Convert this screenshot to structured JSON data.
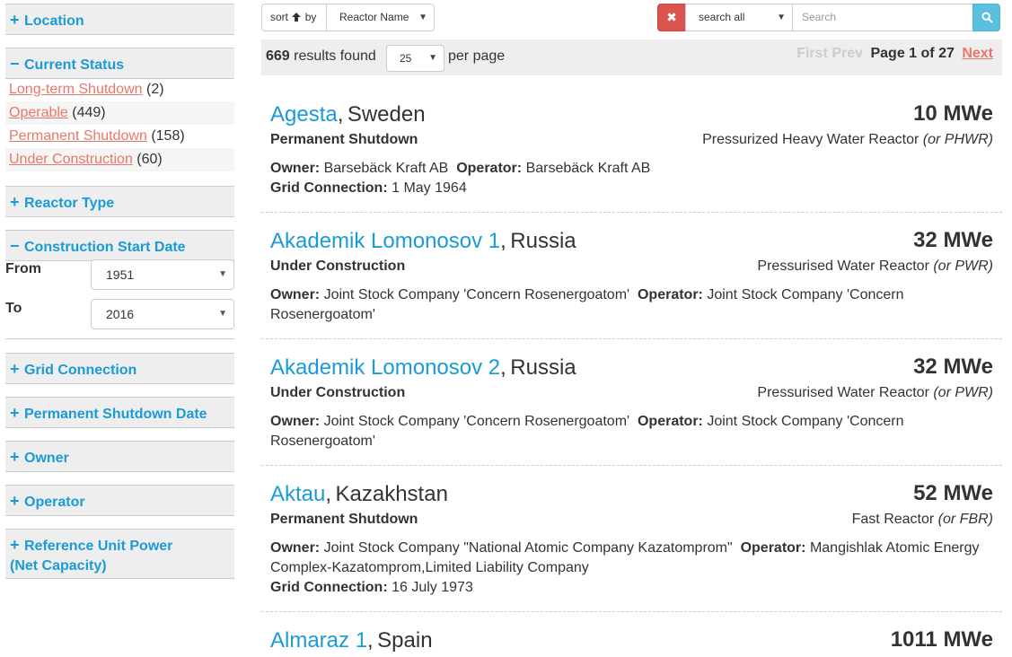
{
  "sidebar": {
    "location": {
      "sym": "+",
      "label": "Location"
    },
    "current_status": {
      "sym": "−",
      "label": "Current Status",
      "items": [
        {
          "label": "Long-term Shutdown",
          "count": "(2)"
        },
        {
          "label": "Operable",
          "count": "(449)"
        },
        {
          "label": "Permanent Shutdown",
          "count": "(158)"
        },
        {
          "label": "Under Construction",
          "count": "(60)"
        }
      ]
    },
    "reactor_type": {
      "sym": "+",
      "label": "Reactor Type"
    },
    "construction_start": {
      "sym": "−",
      "label": "Construction Start Date",
      "from_label": "From",
      "from_value": "1951",
      "to_label": "To",
      "to_value": "2016"
    },
    "grid_connection": {
      "sym": "+",
      "label": "Grid Connection"
    },
    "perm_shutdown_date": {
      "sym": "+",
      "label": "Permanent Shutdown Date"
    },
    "owner": {
      "sym": "+",
      "label": "Owner"
    },
    "operator": {
      "sym": "+",
      "label": "Operator"
    },
    "ref_unit_power": {
      "sym": "+",
      "label_line1": "Reference Unit Power",
      "label_line2": "(Net Capacity)"
    }
  },
  "toolbar": {
    "sort_label": "sort",
    "sort_by": "by",
    "sort_field": "Reactor Name",
    "clear_symbol": "✖",
    "search_scope": "search all",
    "search_placeholder": "Search"
  },
  "results_bar": {
    "count": "669",
    "count_suffix": "results found",
    "per_page_value": "25",
    "per_page_label": "per page",
    "first": "First",
    "prev": "Prev",
    "page_info": "Page 1 of 27",
    "next": "Next"
  },
  "entries": [
    {
      "name": "Agesta",
      "country": "Sweden",
      "power": "10 MWe",
      "status": "Permanent Shutdown",
      "type": "Pressurized Heavy Water Reactor",
      "type_abbr": "(or PHWR)",
      "owner_label": "Owner:",
      "owner": "Barsebäck Kraft AB",
      "operator_label": "Operator:",
      "operator": "Barsebäck Kraft AB",
      "grid_label": "Grid Connection:",
      "grid": "1 May 1964"
    },
    {
      "name": "Akademik Lomonosov 1",
      "country": "Russia",
      "power": "32 MWe",
      "status": "Under Construction",
      "type": "Pressurised Water Reactor",
      "type_abbr": "(or PWR)",
      "owner_label": "Owner:",
      "owner": "Joint Stock Company 'Concern Rosenergoatom'",
      "operator_label": "Operator:",
      "operator": "Joint Stock Company 'Concern Rosenergoatom'"
    },
    {
      "name": "Akademik Lomonosov 2",
      "country": "Russia",
      "power": "32 MWe",
      "status": "Under Construction",
      "type": "Pressurised Water Reactor",
      "type_abbr": "(or PWR)",
      "owner_label": "Owner:",
      "owner": "Joint Stock Company 'Concern Rosenergoatom'",
      "operator_label": "Operator:",
      "operator": "Joint Stock Company 'Concern Rosenergoatom'"
    },
    {
      "name": "Aktau",
      "country": "Kazakhstan",
      "power": "52 MWe",
      "status": "Permanent Shutdown",
      "type": "Fast Reactor",
      "type_abbr": "(or FBR)",
      "owner_label": "Owner:",
      "owner": "Joint Stock Company \"National Atomic Company Kazatomprom\"",
      "operator_label": "Operator:",
      "operator": "Mangishlak Atomic Energy Complex-Kazatomprom,Limited Liability Company",
      "grid_label": "Grid Connection:",
      "grid": "16 July 1973"
    },
    {
      "name": "Almaraz 1",
      "country": "Spain",
      "power": "1011 MWe"
    }
  ],
  "colors": {
    "link_blue": "#1a9bd7",
    "link_salmon": "#e8776a",
    "danger_red": "#d9534f",
    "info_blue": "#5bc0de",
    "panel_gray": "#eeeeee"
  }
}
